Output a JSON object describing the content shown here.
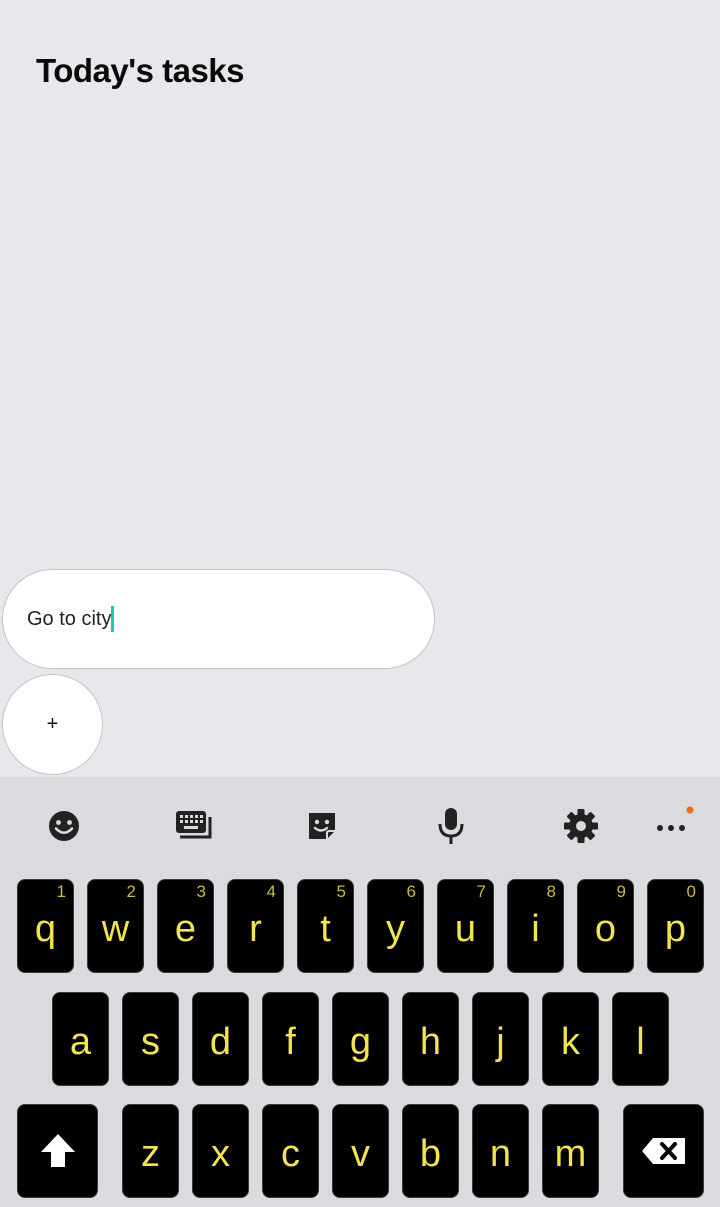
{
  "app": {
    "title": "Today's tasks",
    "task_input": {
      "value": "Go to city"
    },
    "add_button": {
      "label": "+"
    }
  },
  "keyboard": {
    "toolbar": [
      "emoji-icon",
      "keyboard-icon",
      "sticker-icon",
      "microphone-icon",
      "settings-icon",
      "more-icon"
    ],
    "rows": [
      [
        {
          "label": "q",
          "hint": "1"
        },
        {
          "label": "w",
          "hint": "2"
        },
        {
          "label": "e",
          "hint": "3"
        },
        {
          "label": "r",
          "hint": "4"
        },
        {
          "label": "t",
          "hint": "5"
        },
        {
          "label": "y",
          "hint": "6"
        },
        {
          "label": "u",
          "hint": "7"
        },
        {
          "label": "i",
          "hint": "8"
        },
        {
          "label": "o",
          "hint": "9"
        },
        {
          "label": "p",
          "hint": "0"
        }
      ],
      [
        {
          "label": "a"
        },
        {
          "label": "s"
        },
        {
          "label": "d"
        },
        {
          "label": "f"
        },
        {
          "label": "g"
        },
        {
          "label": "h"
        },
        {
          "label": "j"
        },
        {
          "label": "k"
        },
        {
          "label": "l"
        }
      ],
      [
        {
          "label": "z"
        },
        {
          "label": "x"
        },
        {
          "label": "c"
        },
        {
          "label": "v"
        },
        {
          "label": "b"
        },
        {
          "label": "n"
        },
        {
          "label": "m"
        }
      ]
    ],
    "colors": {
      "key_bg": "#000000",
      "key_text": "#f2e34f",
      "accent_dot": "#f26a1b",
      "caret": "#1fc5b5"
    }
  }
}
